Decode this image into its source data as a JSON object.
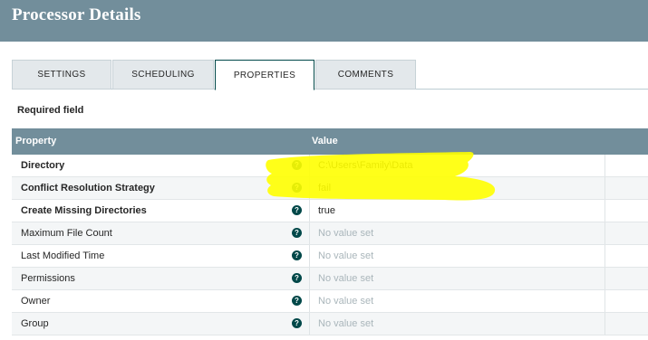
{
  "header": {
    "title": "Processor Details"
  },
  "tabs": [
    {
      "label": "SETTINGS",
      "active": false
    },
    {
      "label": "SCHEDULING",
      "active": false
    },
    {
      "label": "PROPERTIES",
      "active": true
    },
    {
      "label": "COMMENTS",
      "active": false
    }
  ],
  "required_label": "Required field",
  "table": {
    "columns": [
      "Property",
      "Value"
    ],
    "rows": [
      {
        "name": "Directory",
        "required": true,
        "value": "C:\\Users\\Family\\Data",
        "is_set": true
      },
      {
        "name": "Conflict Resolution Strategy",
        "required": true,
        "value": "fail",
        "is_set": true
      },
      {
        "name": "Create Missing Directories",
        "required": true,
        "value": "true",
        "is_set": true
      },
      {
        "name": "Maximum File Count",
        "required": false,
        "value": "No value set",
        "is_set": false
      },
      {
        "name": "Last Modified Time",
        "required": false,
        "value": "No value set",
        "is_set": false
      },
      {
        "name": "Permissions",
        "required": false,
        "value": "No value set",
        "is_set": false
      },
      {
        "name": "Owner",
        "required": false,
        "value": "No value set",
        "is_set": false
      },
      {
        "name": "Group",
        "required": false,
        "value": "No value set",
        "is_set": false
      }
    ],
    "help_glyph": "?"
  },
  "colors": {
    "header_bg": "#728e9b",
    "accent": "#004849",
    "highlight": "#ffff00"
  }
}
